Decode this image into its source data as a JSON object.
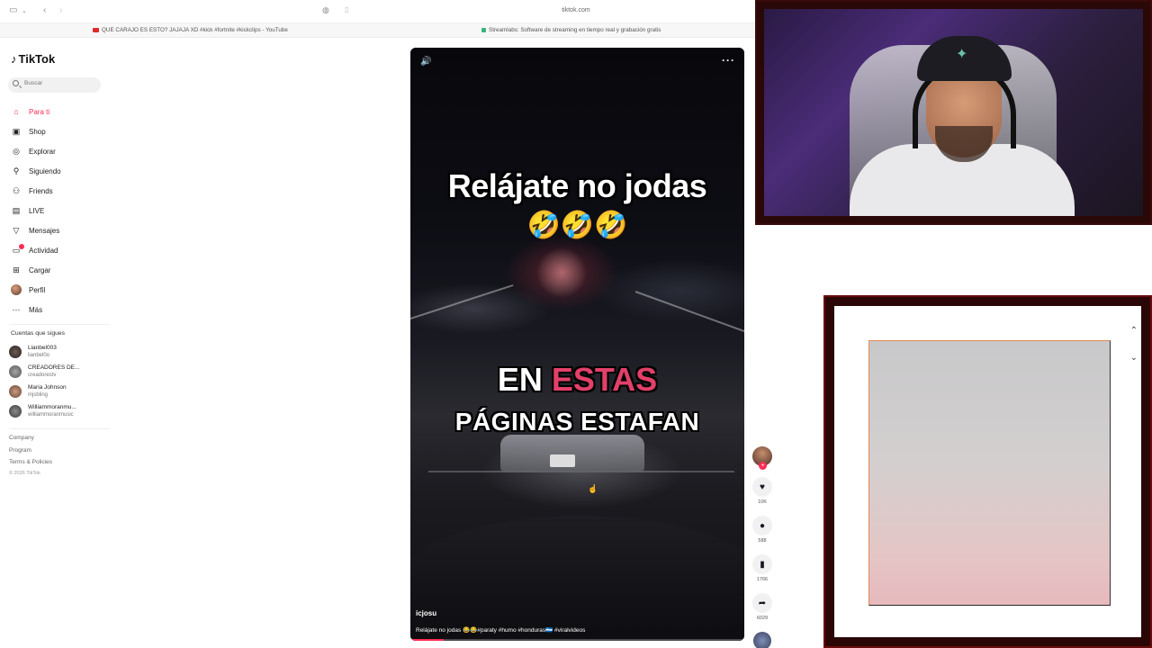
{
  "browser": {
    "url": "tiktok.com",
    "tabs": [
      {
        "title": "QUE CARAJO ES ESTO? JAJAJA XD #kick #fortnite #kickclips - YouTube",
        "color": "#e02a2a"
      },
      {
        "title": "Streamlabs: Software de streaming en tiempo real y grabación gratis",
        "color": "#3bb37a"
      }
    ]
  },
  "sidebar": {
    "logo": "TikTok",
    "search_placeholder": "Buscar",
    "nav": [
      {
        "label": "Para ti",
        "icon": "home-icon",
        "active": true
      },
      {
        "label": "Shop",
        "icon": "shop-icon"
      },
      {
        "label": "Explorar",
        "icon": "compass-icon"
      },
      {
        "label": "Siguiendo",
        "icon": "following-icon"
      },
      {
        "label": "Friends",
        "icon": "friends-icon"
      },
      {
        "label": "LIVE",
        "icon": "live-icon"
      },
      {
        "label": "Mensajes",
        "icon": "messages-icon"
      },
      {
        "label": "Actividad",
        "icon": "activity-icon"
      },
      {
        "label": "Cargar",
        "icon": "upload-icon"
      },
      {
        "label": "Perfil",
        "icon": "profile-avatar"
      },
      {
        "label": "Más",
        "icon": "more-icon"
      }
    ],
    "following_title": "Cuentas que sigues",
    "following": [
      {
        "name": "Lianbel003",
        "handle": "lianbel0o"
      },
      {
        "name": "CREADORES DE...",
        "handle": "creadorestv"
      },
      {
        "name": "Maria Johnson",
        "handle": "mjsbling"
      },
      {
        "name": "Williammoranmu...",
        "handle": "williammoranmusic"
      }
    ],
    "footer_links": [
      "Company",
      "Program",
      "Terms & Policies"
    ],
    "copyright": "© 2026 TikTok"
  },
  "video": {
    "caption_line1": "Relájate no jodas",
    "caption_emojis": "🤣🤣🤣",
    "caption_line2_white": "EN ",
    "caption_line2_pink": "ESTAS",
    "caption_line3": "PÁGINAS ESTAFAN",
    "author": "icjosu",
    "description": "Relájate no jodas 😂😂#paraty #humo #honduras🇭🇳 #viralvideos",
    "progress": 0.1,
    "speaker_icon": "speaker-icon",
    "more_icon": "more-icon"
  },
  "actions": {
    "likes": "10K",
    "comments": "588",
    "saves": "1766",
    "shares": "6029"
  },
  "colors": {
    "accent": "#fe2c55",
    "caption_pink": "#e2406a",
    "frame_dark_red": "#2a0606"
  },
  "pip": {
    "up_icon": "chevron-up-icon",
    "down_icon": "chevron-down-icon"
  }
}
